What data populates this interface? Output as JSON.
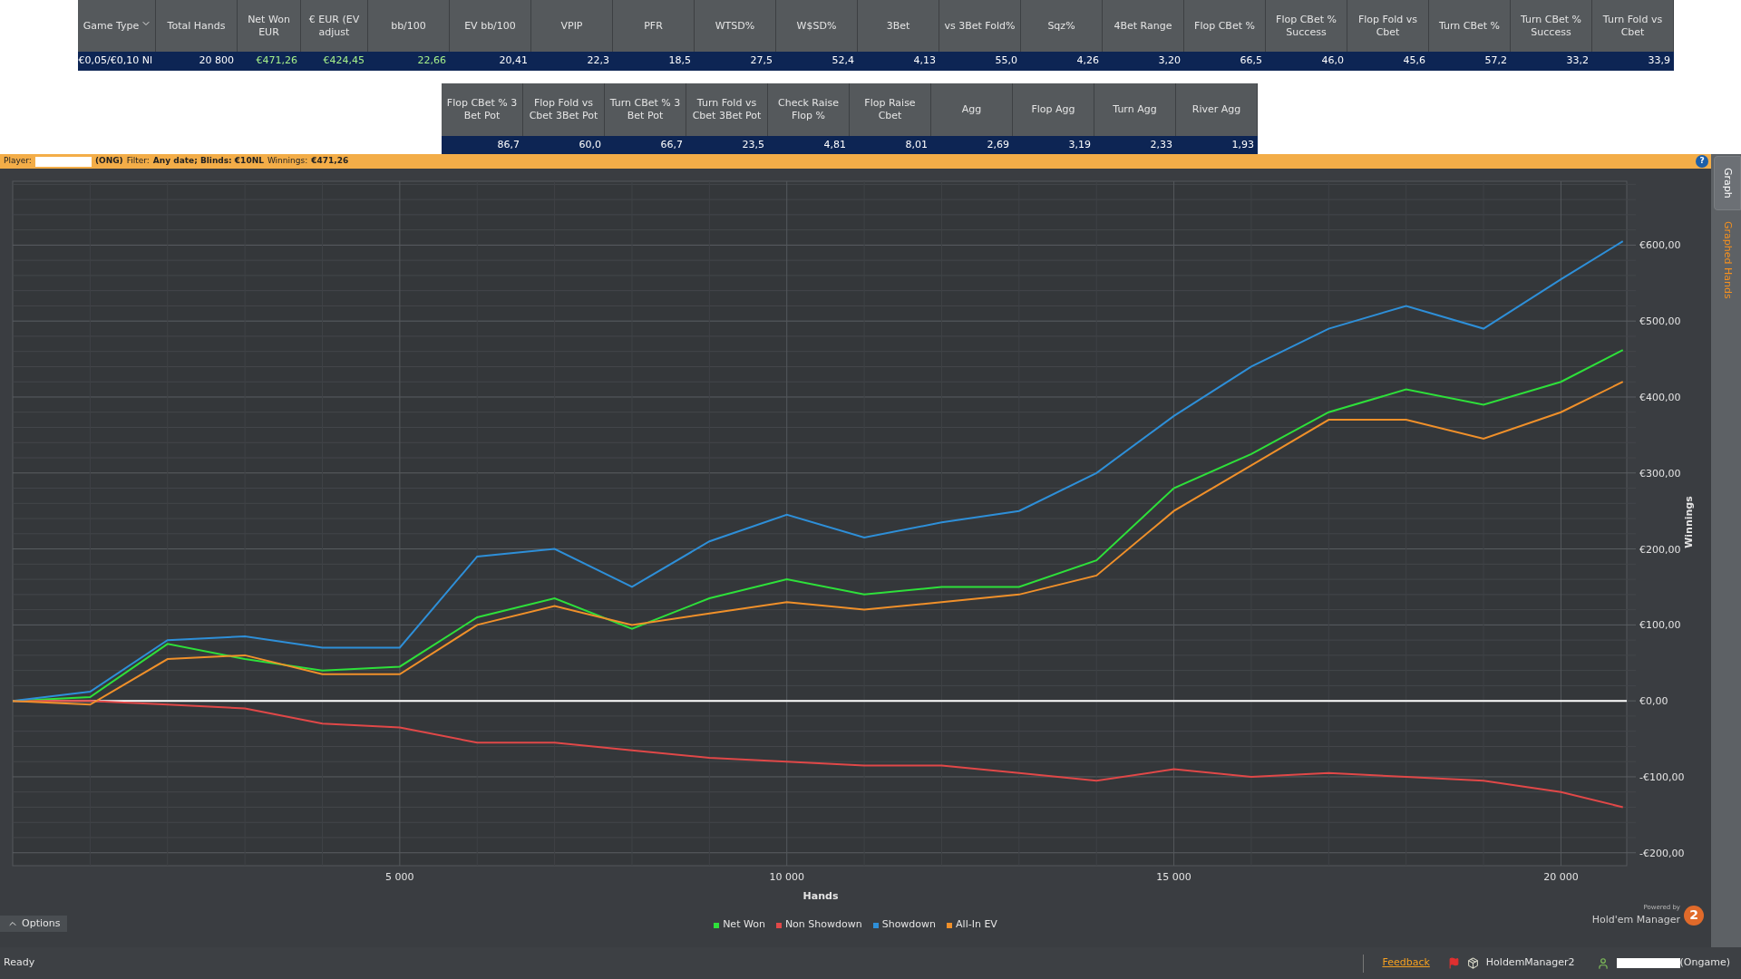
{
  "stats_table": {
    "columns": [
      {
        "label": "Game Type",
        "sortable": true
      },
      {
        "label": "Total Hands",
        "sortable": false
      },
      {
        "label": "Net Won EUR",
        "sortable": false
      },
      {
        "label": "€ EUR (EV adjust",
        "sortable": false
      },
      {
        "label": "bb/100",
        "sortable": false
      },
      {
        "label": "EV bb/100",
        "sortable": false
      },
      {
        "label": "VPIP",
        "sortable": false
      },
      {
        "label": "PFR",
        "sortable": false
      },
      {
        "label": "WTSD%",
        "sortable": false
      },
      {
        "label": "W$SD%",
        "sortable": false
      },
      {
        "label": "3Bet",
        "sortable": false
      },
      {
        "label": "vs 3Bet Fold%",
        "sortable": false
      },
      {
        "label": "Sqz%",
        "sortable": false
      },
      {
        "label": "4Bet Range",
        "sortable": false
      },
      {
        "label": "Flop CBet %",
        "sortable": false
      },
      {
        "label": "Flop CBet % Success",
        "sortable": false
      },
      {
        "label": "Flop Fold vs Cbet",
        "sortable": false
      },
      {
        "label": "Turn CBet %",
        "sortable": false
      },
      {
        "label": "Turn CBet % Success",
        "sortable": false
      },
      {
        "label": "Turn Fold vs Cbet",
        "sortable": false
      }
    ],
    "row": [
      {
        "value": "€0,05/€0,10 Nl",
        "positive": false
      },
      {
        "value": "20 800",
        "positive": false
      },
      {
        "value": "€471,26",
        "positive": true
      },
      {
        "value": "€424,45",
        "positive": true
      },
      {
        "value": "22,66",
        "positive": true
      },
      {
        "value": "20,41",
        "positive": false
      },
      {
        "value": "22,3",
        "positive": false
      },
      {
        "value": "18,5",
        "positive": false
      },
      {
        "value": "27,5",
        "positive": false
      },
      {
        "value": "52,4",
        "positive": false
      },
      {
        "value": "4,13",
        "positive": false
      },
      {
        "value": "55,0",
        "positive": false
      },
      {
        "value": "4,26",
        "positive": false
      },
      {
        "value": "3,20",
        "positive": false
      },
      {
        "value": "66,5",
        "positive": false
      },
      {
        "value": "46,0",
        "positive": false
      },
      {
        "value": "45,6",
        "positive": false
      },
      {
        "value": "57,2",
        "positive": false
      },
      {
        "value": "33,2",
        "positive": false
      },
      {
        "value": "33,9",
        "positive": false
      }
    ]
  },
  "postflop_table": {
    "columns": [
      "Flop CBet % 3 Bet Pot",
      "Flop Fold vs Cbet 3Bet Pot",
      "Turn CBet % 3 Bet Pot",
      "Turn Fold vs Cbet 3Bet Pot",
      "Check Raise Flop %",
      "Flop Raise Cbet",
      "Agg",
      "Flop Agg",
      "Turn Agg",
      "River Agg"
    ],
    "row": [
      "86,7",
      "60,0",
      "66,7",
      "23,5",
      "4,81",
      "8,01",
      "2,69",
      "3,19",
      "2,33",
      "1,93"
    ]
  },
  "filter_bar": {
    "player_label": "Player:",
    "site": "(ONG)",
    "filter_label": "Filter:",
    "filter": "Any date; Blinds: €10NL",
    "winnings_label": "Winnings:",
    "winnings": "€471,26",
    "help": "?"
  },
  "side_tabs": [
    {
      "label": "Graph",
      "selected": true
    },
    {
      "label": "Graphed Hands",
      "selected": false
    }
  ],
  "chart": {
    "chart_data": {
      "type": "line",
      "grid": true,
      "xlabel": "Hands",
      "ylabel": "Winnings",
      "x": [
        0,
        1000,
        2000,
        3000,
        4000,
        5000,
        6000,
        7000,
        8000,
        9000,
        10000,
        11000,
        12000,
        13000,
        14000,
        15000,
        16000,
        17000,
        18000,
        19000,
        20000,
        20800
      ],
      "xlim": [
        0,
        20850
      ],
      "ylim": [
        -217,
        684
      ],
      "xticks": [
        {
          "value": 5000,
          "label": "5 000"
        },
        {
          "value": 10000,
          "label": "10 000"
        },
        {
          "value": 15000,
          "label": "15 000"
        },
        {
          "value": 20000,
          "label": "20 000"
        }
      ],
      "yticks": [
        {
          "value": 600,
          "label": "€600,00"
        },
        {
          "value": 500,
          "label": "€500,00"
        },
        {
          "value": 400,
          "label": "€400,00"
        },
        {
          "value": 300,
          "label": "€300,00"
        },
        {
          "value": 200,
          "label": "€200,00"
        },
        {
          "value": 100,
          "label": "€100,00"
        },
        {
          "value": 0,
          "label": "€0,00"
        },
        {
          "value": -100,
          "label": "-€100,00"
        },
        {
          "value": -200,
          "label": "-€200,00"
        }
      ],
      "series": [
        {
          "name": "Net Won",
          "color": "#2ee03a",
          "values": [
            0,
            5,
            75,
            55,
            40,
            45,
            110,
            135,
            95,
            135,
            160,
            140,
            150,
            150,
            185,
            280,
            325,
            380,
            410,
            390,
            420,
            462
          ]
        },
        {
          "name": "Non Showdown",
          "color": "#e04848",
          "values": [
            0,
            0,
            -5,
            -10,
            -30,
            -35,
            -55,
            -55,
            -65,
            -75,
            -80,
            -85,
            -85,
            -95,
            -105,
            -90,
            -100,
            -95,
            -100,
            -105,
            -120,
            -140
          ]
        },
        {
          "name": "Showdown",
          "color": "#2e8fd8",
          "values": [
            0,
            12,
            80,
            85,
            70,
            70,
            190,
            200,
            150,
            210,
            245,
            215,
            235,
            250,
            300,
            375,
            440,
            490,
            520,
            490,
            555,
            605
          ]
        },
        {
          "name": "All-In EV",
          "color": "#f0902a",
          "values": [
            0,
            -5,
            55,
            60,
            35,
            35,
            100,
            125,
            100,
            115,
            130,
            120,
            130,
            140,
            165,
            250,
            310,
            370,
            370,
            345,
            380,
            420
          ]
        }
      ]
    }
  },
  "options_button": "Options",
  "logo": {
    "tagline": "Powered by",
    "name": "Hold'em Manager",
    "badge": "2"
  },
  "status_bar": {
    "status": "Ready",
    "feedback_link": "Feedback",
    "app": "HoldemManager2",
    "network": "(Ongame)"
  }
}
